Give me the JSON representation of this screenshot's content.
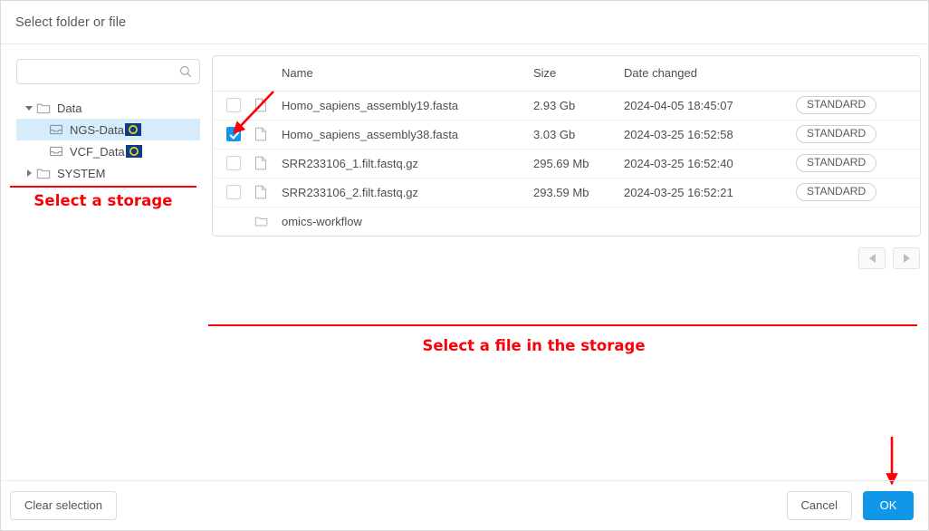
{
  "header": {
    "title": "Select folder or file"
  },
  "search": {
    "value": "",
    "placeholder": "",
    "icon": "search-icon"
  },
  "tree": {
    "items": [
      {
        "label": "Data",
        "level": 0,
        "icon": "folder-icon",
        "caret": "open",
        "selected": false,
        "badge": null
      },
      {
        "label": "NGS-Data",
        "level": 1,
        "icon": "storage-icon",
        "caret": "none",
        "selected": true,
        "badge": "eu-flag-badge"
      },
      {
        "label": "VCF_Data",
        "level": 1,
        "icon": "storage-icon",
        "caret": "none",
        "selected": false,
        "badge": "eu-flag-badge"
      },
      {
        "label": "SYSTEM",
        "level": 0,
        "icon": "folder-icon",
        "caret": "closed",
        "selected": false,
        "badge": null
      }
    ]
  },
  "table": {
    "columns": [
      "",
      "",
      "Name",
      "Size",
      "Date changed",
      ""
    ],
    "rows": [
      {
        "checked": false,
        "has_checkbox": true,
        "icon": "file-icon",
        "name": "Homo_sapiens_assembly19.fasta",
        "size": "2.93 Gb",
        "date": "2024-04-05 18:45:07",
        "storage_class": "STANDARD"
      },
      {
        "checked": true,
        "has_checkbox": true,
        "icon": "file-icon",
        "name": "Homo_sapiens_assembly38.fasta",
        "size": "3.03 Gb",
        "date": "2024-03-25 16:52:58",
        "storage_class": "STANDARD"
      },
      {
        "checked": false,
        "has_checkbox": true,
        "icon": "file-icon",
        "name": "SRR233106_1.filt.fastq.gz",
        "size": "295.69 Mb",
        "date": "2024-03-25 16:52:40",
        "storage_class": "STANDARD"
      },
      {
        "checked": false,
        "has_checkbox": true,
        "icon": "file-icon",
        "name": "SRR233106_2.filt.fastq.gz",
        "size": "293.59 Mb",
        "date": "2024-03-25 16:52:21",
        "storage_class": "STANDARD"
      },
      {
        "checked": false,
        "has_checkbox": false,
        "icon": "folder-icon",
        "name": "omics-workflow",
        "size": "",
        "date": "",
        "storage_class": ""
      }
    ]
  },
  "pagination": {
    "prev_icon": "triangle-left-icon",
    "next_icon": "triangle-right-icon"
  },
  "annotations": {
    "left_label": "Select a storage",
    "right_label": "Select a file in the storage",
    "color": "#fb0007"
  },
  "footer": {
    "clear_label": "Clear selection",
    "cancel_label": "Cancel",
    "ok_label": "OK"
  },
  "colors": {
    "accent": "#1296e8",
    "selected_row": "#d6ecfb",
    "annotation_red": "#fb0007",
    "badge_blue": "#0b3d8c",
    "badge_yellow": "#f5d312"
  }
}
